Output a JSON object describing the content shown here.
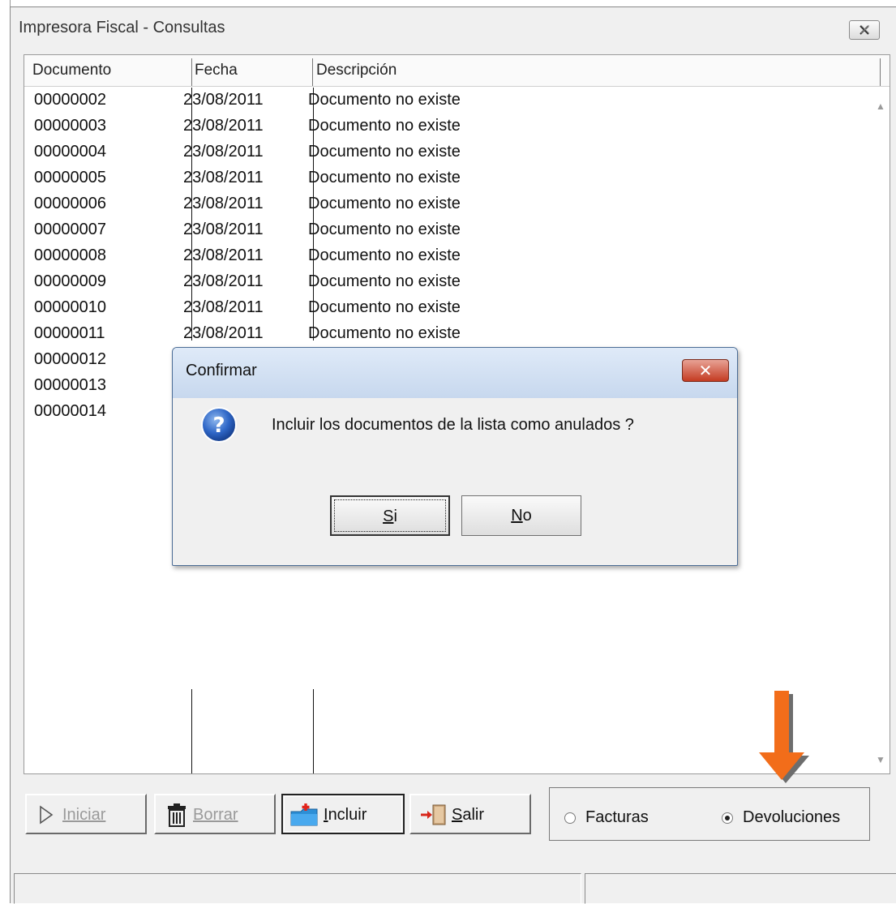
{
  "window": {
    "title": "Impresora Fiscal - Consultas"
  },
  "list": {
    "columns": [
      "Documento",
      "Fecha",
      "Descripción"
    ],
    "rows": [
      {
        "doc": "00000002",
        "fecha": "23/08/2011",
        "desc": "Documento no existe"
      },
      {
        "doc": "00000003",
        "fecha": "23/08/2011",
        "desc": "Documento no existe"
      },
      {
        "doc": "00000004",
        "fecha": "23/08/2011",
        "desc": "Documento no existe"
      },
      {
        "doc": "00000005",
        "fecha": "23/08/2011",
        "desc": "Documento no existe"
      },
      {
        "doc": "00000006",
        "fecha": "23/08/2011",
        "desc": "Documento no existe"
      },
      {
        "doc": "00000007",
        "fecha": "23/08/2011",
        "desc": "Documento no existe"
      },
      {
        "doc": "00000008",
        "fecha": "23/08/2011",
        "desc": "Documento no existe"
      },
      {
        "doc": "00000009",
        "fecha": "23/08/2011",
        "desc": "Documento no existe"
      },
      {
        "doc": "00000010",
        "fecha": "23/08/2011",
        "desc": "Documento no existe"
      },
      {
        "doc": "00000011",
        "fecha": "23/08/2011",
        "desc": "Documento no existe"
      },
      {
        "doc": "00000012",
        "fecha": "",
        "desc": ""
      },
      {
        "doc": "00000013",
        "fecha": "",
        "desc": ""
      },
      {
        "doc": "00000014",
        "fecha": "",
        "desc": ""
      }
    ]
  },
  "toolbar": {
    "iniciar": "Iniciar",
    "borrar": "Borrar",
    "incluir": "Incluir",
    "salir": "Salir"
  },
  "options": {
    "facturas": "Facturas",
    "devoluciones": "Devoluciones",
    "selected": "devoluciones"
  },
  "dialog": {
    "title": "Confirmar",
    "message": "Incluir los documentos de la lista como anulados ?",
    "yes": "Si",
    "no": "No"
  },
  "colors": {
    "arrow": "#f26d1a",
    "dialog_border": "#4c6d96",
    "close_red": "#c43b22"
  }
}
